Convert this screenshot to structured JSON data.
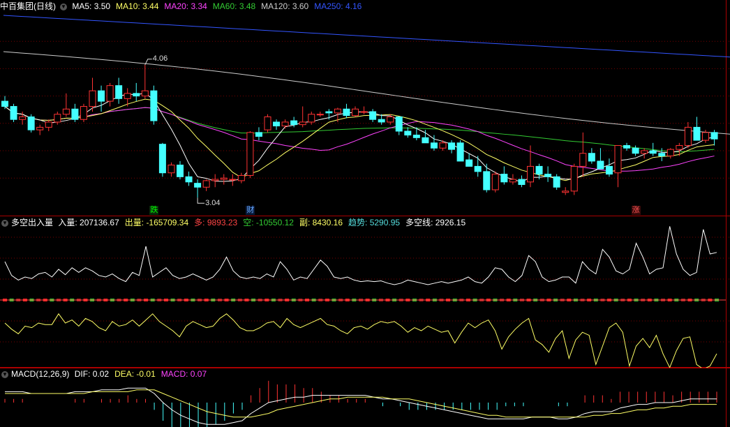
{
  "main": {
    "title": "中百集团(日线)",
    "ma_labels": [
      {
        "name": "MA5: ",
        "value": "3.50",
        "color": "#ffffff"
      },
      {
        "name": "MA10: ",
        "value": "3.44",
        "color": "#ffff66"
      },
      {
        "name": "MA20: ",
        "value": "3.34",
        "color": "#ff44ff"
      },
      {
        "name": "MA60: ",
        "value": "3.48",
        "color": "#33cc33"
      },
      {
        "name": "MA120: ",
        "value": "3.60",
        "color": "#cccccc"
      },
      {
        "name": "MA250: ",
        "value": "4.16",
        "color": "#3355ff"
      }
    ],
    "high_label": "4.06",
    "low_label": "3.04",
    "markers": [
      {
        "text": "跌",
        "color": "#00ff00",
        "bg": "#0a2a0a"
      },
      {
        "text": "财",
        "color": "#66aaff",
        "bg": "#0a1a3a"
      },
      {
        "text": "涨",
        "color": "#ff5555",
        "bg": "#3a0a0a"
      }
    ]
  },
  "flow": {
    "title": "多空出入量",
    "items": [
      {
        "name": "入量: ",
        "value": "207136.67",
        "color": "#ffffff"
      },
      {
        "name": "出量: ",
        "value": "-165709.34",
        "color": "#ffff66"
      },
      {
        "name": "多: ",
        "value": "9893.23",
        "color": "#ff4444"
      },
      {
        "name": "空: ",
        "value": "-10550.12",
        "color": "#33cc33"
      },
      {
        "name": "副: ",
        "value": "8430.16",
        "color": "#ffff66"
      },
      {
        "name": "趋势: ",
        "value": "5290.95",
        "color": "#55dddd"
      },
      {
        "name": "多空线: ",
        "value": "2926.15",
        "color": "#ffffff"
      }
    ]
  },
  "macd": {
    "title": "MACD(12,26,9)",
    "items": [
      {
        "name": "DIF: ",
        "value": "0.02",
        "color": "#ffffff"
      },
      {
        "name": "DEA: ",
        "value": "-0.01",
        "color": "#ffff66"
      },
      {
        "name": "MACD: ",
        "value": "0.07",
        "color": "#ff44ff"
      }
    ]
  },
  "colors": {
    "up": "#ff3333",
    "down": "#44ffff",
    "grid": "#7a0000",
    "frame": "#aa0000"
  },
  "chart_data": [
    {
      "type": "candlestick",
      "title": "中百集团(日线)",
      "ohlc": [
        [
          3.78,
          3.82,
          3.72,
          3.74
        ],
        [
          3.74,
          3.76,
          3.62,
          3.64
        ],
        [
          3.64,
          3.7,
          3.6,
          3.66
        ],
        [
          3.66,
          3.68,
          3.54,
          3.56
        ],
        [
          3.56,
          3.6,
          3.52,
          3.58
        ],
        [
          3.58,
          3.64,
          3.55,
          3.62
        ],
        [
          3.62,
          3.7,
          3.6,
          3.68
        ],
        [
          3.68,
          3.84,
          3.66,
          3.72
        ],
        [
          3.72,
          3.76,
          3.62,
          3.64
        ],
        [
          3.64,
          3.76,
          3.62,
          3.74
        ],
        [
          3.74,
          3.96,
          3.7,
          3.86
        ],
        [
          3.86,
          3.9,
          3.7,
          3.78
        ],
        [
          3.78,
          3.92,
          3.74,
          3.9
        ],
        [
          3.9,
          3.96,
          3.76,
          3.8
        ],
        [
          3.8,
          3.88,
          3.74,
          3.84
        ],
        [
          3.84,
          3.92,
          3.78,
          3.82
        ],
        [
          3.82,
          4.06,
          3.8,
          3.86
        ],
        [
          3.86,
          3.9,
          3.6,
          3.63
        ],
        [
          3.45,
          3.46,
          3.2,
          3.23
        ],
        [
          3.23,
          3.31,
          3.2,
          3.29
        ],
        [
          3.29,
          3.32,
          3.18,
          3.2
        ],
        [
          3.2,
          3.24,
          3.13,
          3.16
        ],
        [
          3.15,
          3.18,
          3.04,
          3.12
        ],
        [
          3.12,
          3.18,
          3.09,
          3.17
        ],
        [
          3.17,
          3.22,
          3.12,
          3.18
        ],
        [
          3.18,
          3.22,
          3.14,
          3.19
        ],
        [
          3.18,
          3.22,
          3.13,
          3.18
        ],
        [
          3.17,
          3.23,
          3.15,
          3.21
        ],
        [
          3.21,
          3.55,
          3.19,
          3.54
        ],
        [
          3.54,
          3.58,
          3.48,
          3.51
        ],
        [
          3.56,
          3.68,
          3.54,
          3.66
        ],
        [
          3.62,
          3.64,
          3.56,
          3.59
        ],
        [
          3.59,
          3.64,
          3.57,
          3.62
        ],
        [
          3.63,
          3.66,
          3.58,
          3.6
        ],
        [
          3.6,
          3.74,
          3.58,
          3.62
        ],
        [
          3.62,
          3.7,
          3.6,
          3.68
        ],
        [
          3.68,
          3.7,
          3.66,
          3.68
        ],
        [
          3.7,
          3.72,
          3.64,
          3.69
        ],
        [
          3.69,
          3.73,
          3.62,
          3.72
        ],
        [
          3.72,
          3.76,
          3.65,
          3.67
        ],
        [
          3.67,
          3.74,
          3.66,
          3.72
        ],
        [
          3.7,
          3.74,
          3.68,
          3.7
        ],
        [
          3.7,
          3.72,
          3.62,
          3.64
        ],
        [
          3.64,
          3.68,
          3.6,
          3.62
        ],
        [
          3.62,
          3.68,
          3.6,
          3.66
        ],
        [
          3.66,
          3.66,
          3.52,
          3.55
        ],
        [
          3.55,
          3.58,
          3.5,
          3.52
        ],
        [
          3.52,
          3.58,
          3.48,
          3.5
        ],
        [
          3.5,
          3.56,
          3.48,
          3.46
        ],
        [
          3.46,
          3.52,
          3.4,
          3.42
        ],
        [
          3.42,
          3.48,
          3.4,
          3.46
        ],
        [
          3.46,
          3.48,
          3.38,
          3.41
        ],
        [
          3.46,
          3.48,
          3.36,
          3.32
        ],
        [
          3.33,
          3.38,
          3.28,
          3.28
        ],
        [
          3.28,
          3.36,
          3.2,
          3.24
        ],
        [
          3.24,
          3.3,
          3.08,
          3.1
        ],
        [
          3.1,
          3.24,
          3.08,
          3.22
        ],
        [
          3.22,
          3.28,
          3.14,
          3.16
        ],
        [
          3.16,
          3.22,
          3.14,
          3.18
        ],
        [
          3.18,
          3.21,
          3.12,
          3.14
        ],
        [
          3.16,
          3.44,
          3.12,
          3.28
        ],
        [
          3.28,
          3.3,
          3.18,
          3.22
        ],
        [
          3.22,
          3.28,
          3.16,
          3.2
        ],
        [
          3.2,
          3.22,
          3.1,
          3.12
        ],
        [
          3.08,
          3.12,
          3.06,
          3.09
        ],
        [
          3.09,
          3.3,
          3.06,
          3.28
        ],
        [
          3.28,
          3.54,
          3.2,
          3.38
        ],
        [
          3.38,
          3.42,
          3.3,
          3.32
        ],
        [
          3.32,
          3.42,
          3.28,
          3.26
        ],
        [
          3.28,
          3.34,
          3.2,
          3.22
        ],
        [
          3.23,
          3.44,
          3.12,
          3.44
        ],
        [
          3.44,
          3.46,
          3.4,
          3.42
        ],
        [
          3.42,
          3.44,
          3.36,
          3.38
        ],
        [
          3.38,
          3.42,
          3.34,
          3.4
        ],
        [
          3.4,
          3.46,
          3.36,
          3.38
        ],
        [
          3.38,
          3.42,
          3.32,
          3.36
        ],
        [
          3.36,
          3.42,
          3.34,
          3.41
        ],
        [
          3.41,
          3.46,
          3.36,
          3.44
        ],
        [
          3.44,
          3.62,
          3.42,
          3.58
        ],
        [
          3.58,
          3.66,
          3.48,
          3.48
        ],
        [
          3.48,
          3.56,
          3.46,
          3.54
        ],
        [
          3.54,
          3.56,
          3.44,
          3.49
        ]
      ],
      "high_label": "4.06",
      "low_label": "3.04"
    },
    {
      "type": "line",
      "title": "多空出入量",
      "series": [
        {
          "name": "入量",
          "values": [
            0.5,
            0.32,
            0.26,
            0.3,
            0.28,
            0.34,
            0.36,
            0.3,
            0.4,
            0.33,
            0.42,
            0.36,
            0.42,
            0.38,
            0.32,
            0.3,
            0.34,
            0.28,
            0.24,
            0.36,
            0.32,
            0.7,
            0.3,
            0.36,
            0.42,
            0.32,
            0.28,
            0.3,
            0.34,
            0.3,
            0.26,
            0.3,
            0.4,
            0.56,
            0.38,
            0.3,
            0.28,
            0.3,
            0.28,
            0.34,
            0.3,
            0.5,
            0.4,
            0.26,
            0.3,
            0.28,
            0.4,
            0.52,
            0.44,
            0.3,
            0.28,
            0.3,
            0.26,
            0.24,
            0.25,
            0.24,
            0.25,
            0.22,
            0.2,
            0.22,
            0.26,
            0.24,
            0.22,
            0.2,
            0.22,
            0.24,
            0.22,
            0.24,
            0.26,
            0.3,
            0.24,
            0.22,
            0.3,
            0.42,
            0.4,
            0.3,
            0.24,
            0.32,
            0.58,
            0.5,
            0.3,
            0.24,
            0.26,
            0.3,
            0.3,
            0.22,
            0.5,
            0.4,
            0.34,
            0.66,
            0.56,
            0.38,
            0.34,
            0.4,
            0.74,
            0.56,
            0.34,
            0.4,
            0.42,
            0.96,
            0.6,
            0.4,
            0.32,
            0.36,
            0.92,
            0.6,
            0.62
          ]
        },
        {
          "name": "出量",
          "values": [
            -0.3,
            -0.38,
            -0.44,
            -0.34,
            -0.36,
            -0.3,
            -0.32,
            -0.32,
            -0.18,
            -0.3,
            -0.26,
            -0.34,
            -0.24,
            -0.28,
            -0.36,
            -0.4,
            -0.28,
            -0.34,
            -0.32,
            -0.26,
            -0.34,
            -0.26,
            -0.18,
            -0.28,
            -0.34,
            -0.4,
            -0.48,
            -0.34,
            -0.28,
            -0.32,
            -0.36,
            -0.34,
            -0.24,
            -0.18,
            -0.26,
            -0.36,
            -0.4,
            -0.4,
            -0.36,
            -0.3,
            -0.28,
            -0.36,
            -0.24,
            -0.32,
            -0.36,
            -0.32,
            -0.28,
            -0.24,
            -0.32,
            -0.34,
            -0.4,
            -0.44,
            -0.36,
            -0.34,
            -0.38,
            -0.32,
            -0.28,
            -0.3,
            -0.28,
            -0.34,
            -0.42,
            -0.36,
            -0.4,
            -0.34,
            -0.38,
            -0.42,
            -0.4,
            -0.56,
            -0.42,
            -0.3,
            -0.36,
            -0.3,
            -0.26,
            -0.4,
            -0.64,
            -0.48,
            -0.38,
            -0.3,
            -0.24,
            -0.52,
            -0.58,
            -0.68,
            -0.5,
            -0.4,
            -0.76,
            -0.52,
            -0.42,
            -0.46,
            -0.84,
            -0.6,
            -0.36,
            -0.3,
            -0.42,
            -0.86,
            -0.6,
            -0.5,
            -0.62,
            -0.46,
            -0.7,
            -0.88,
            -0.66,
            -0.5,
            -0.48,
            -0.84,
            -0.9,
            -0.86,
            -0.7
          ]
        }
      ]
    },
    {
      "type": "line",
      "title": "MACD(12,26,9)",
      "series": [
        {
          "name": "DIF",
          "values": [
            0.06,
            0.06,
            0.06,
            0.05,
            0.05,
            0.05,
            0.05,
            0.05,
            0.06,
            0.06,
            0.06,
            0.07,
            0.07,
            0.07,
            0.08,
            0.08,
            0.08,
            0.05,
            0.0,
            -0.04,
            -0.07,
            -0.09,
            -0.11,
            -0.12,
            -0.12,
            -0.12,
            -0.11,
            -0.1,
            -0.06,
            -0.03,
            0.0,
            0.01,
            0.02,
            0.03,
            0.03,
            0.04,
            0.04,
            0.04,
            0.04,
            0.04,
            0.04,
            0.04,
            0.03,
            0.02,
            0.02,
            0.01,
            0.0,
            -0.01,
            -0.02,
            -0.03,
            -0.04,
            -0.05,
            -0.06,
            -0.07,
            -0.08,
            -0.09,
            -0.09,
            -0.09,
            -0.09,
            -0.09,
            -0.08,
            -0.08,
            -0.08,
            -0.09,
            -0.09,
            -0.08,
            -0.06,
            -0.05,
            -0.05,
            -0.05,
            -0.03,
            -0.02,
            -0.01,
            -0.01,
            0.0,
            0.0,
            0.0,
            0.01,
            0.02,
            0.02,
            0.02,
            0.02
          ]
        },
        {
          "name": "DEA",
          "values": [
            0.05,
            0.05,
            0.05,
            0.05,
            0.05,
            0.05,
            0.05,
            0.05,
            0.05,
            0.05,
            0.06,
            0.06,
            0.06,
            0.06,
            0.06,
            0.07,
            0.07,
            0.07,
            0.05,
            0.03,
            0.01,
            -0.01,
            -0.03,
            -0.05,
            -0.06,
            -0.07,
            -0.08,
            -0.08,
            -0.08,
            -0.07,
            -0.06,
            -0.04,
            -0.03,
            -0.02,
            -0.01,
            0.0,
            0.01,
            0.02,
            0.02,
            0.03,
            0.03,
            0.03,
            0.03,
            0.03,
            0.02,
            0.02,
            0.02,
            0.01,
            0.0,
            -0.01,
            -0.02,
            -0.03,
            -0.04,
            -0.05,
            -0.06,
            -0.07,
            -0.07,
            -0.08,
            -0.08,
            -0.08,
            -0.08,
            -0.08,
            -0.08,
            -0.08,
            -0.08,
            -0.08,
            -0.08,
            -0.07,
            -0.07,
            -0.06,
            -0.06,
            -0.05,
            -0.04,
            -0.04,
            -0.03,
            -0.03,
            -0.02,
            -0.02,
            -0.01,
            -0.01,
            -0.01,
            -0.01
          ]
        }
      ]
    }
  ]
}
